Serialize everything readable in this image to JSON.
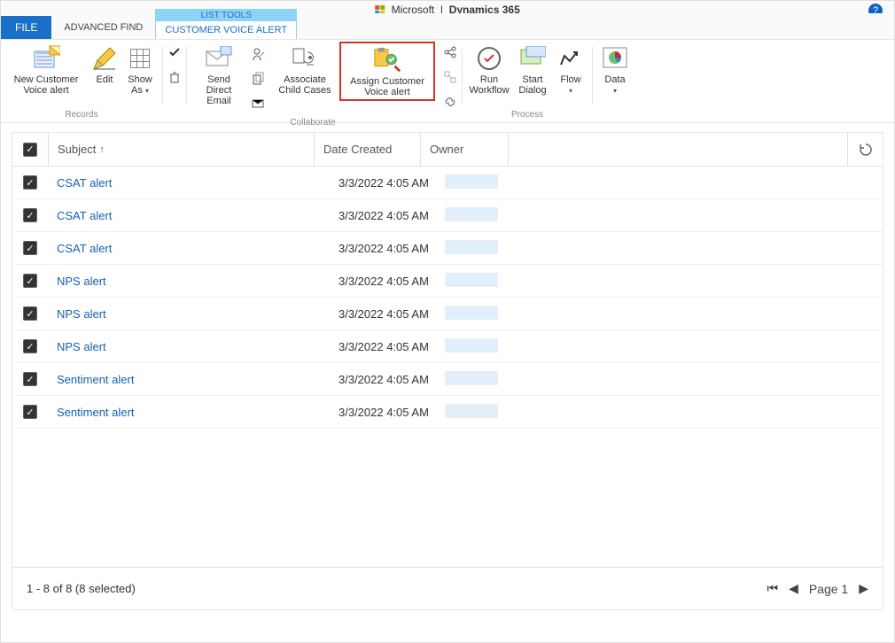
{
  "header": {
    "brand_company": "Microsoft",
    "brand_product": "Dynamics 365"
  },
  "tabs": {
    "file": "FILE",
    "advanced_find": "ADVANCED FIND",
    "list_tools_super": "LIST TOOLS",
    "list_tools_main": "CUSTOMER VOICE ALERT"
  },
  "ribbon": {
    "records": {
      "label": "Records",
      "new_alert": "New Customer Voice alert",
      "edit": "Edit",
      "show_as": "Show As"
    },
    "collaborate": {
      "label": "Collaborate",
      "send_email": "Send Direct Email",
      "associate_child": "Associate Child Cases",
      "assign_alert": "Assign Customer Voice alert"
    },
    "process": {
      "label": "Process",
      "run_workflow": "Run Workflow",
      "start_dialog": "Start Dialog",
      "flow": "Flow"
    },
    "data": "Data"
  },
  "grid": {
    "columns": {
      "subject": "Subject",
      "date_created": "Date Created",
      "owner": "Owner"
    },
    "rows": [
      {
        "subject": "CSAT alert",
        "date": "3/3/2022 4:05 AM"
      },
      {
        "subject": "CSAT alert",
        "date": "3/3/2022 4:05 AM"
      },
      {
        "subject": "CSAT alert",
        "date": "3/3/2022 4:05 AM"
      },
      {
        "subject": "NPS alert",
        "date": "3/3/2022 4:05 AM"
      },
      {
        "subject": "NPS alert",
        "date": "3/3/2022 4:05 AM"
      },
      {
        "subject": "NPS alert",
        "date": "3/3/2022 4:05 AM"
      },
      {
        "subject": "Sentiment alert",
        "date": "3/3/2022 4:05 AM"
      },
      {
        "subject": "Sentiment alert",
        "date": "3/3/2022 4:05 AM"
      }
    ],
    "footer_status": "1 - 8 of 8 (8 selected)",
    "page_label": "Page 1"
  }
}
